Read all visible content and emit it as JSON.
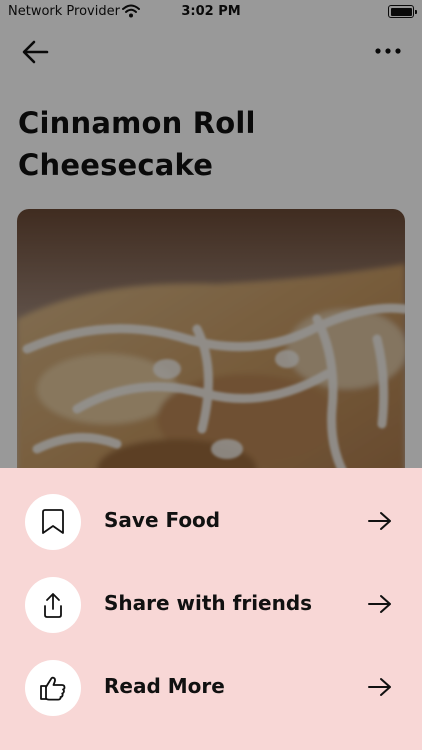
{
  "status_bar": {
    "carrier": "Network Provider",
    "time": "3:02 PM"
  },
  "nav": {
    "back_icon": "arrow-left-icon",
    "more_icon": "more-horizontal-icon"
  },
  "recipe": {
    "title": "Cinnamon Roll Cheesecake"
  },
  "actions": [
    {
      "label": "Save Food",
      "icon": "bookmark-icon"
    },
    {
      "label": "Share with friends",
      "icon": "share-icon"
    },
    {
      "label": "Read More",
      "icon": "thumbs-up-hand-icon"
    }
  ],
  "colors": {
    "sheet_background": "#f8d7d6",
    "overlay": "rgba(0,0,0,0.40)",
    "text": "#111111"
  }
}
